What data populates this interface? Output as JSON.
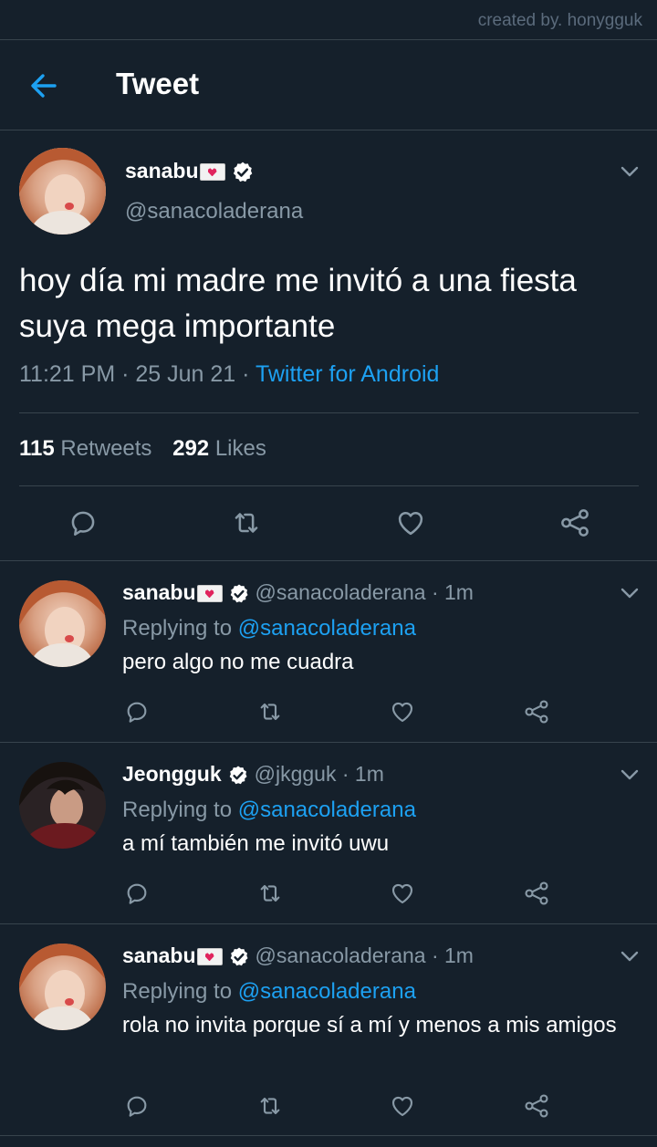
{
  "credit": "created by. honygguk",
  "header": {
    "title": "Tweet"
  },
  "main_tweet": {
    "name": "sanabu",
    "handle": "@sanacoladerana",
    "text": "hoy día mi madre me invitó a una fiesta suya mega importante",
    "time": "11:21 PM · 25 Jun 21 · ",
    "source": "Twitter for Android",
    "retweets_count": "115",
    "retweets_label": "Retweets",
    "likes_count": "292",
    "likes_label": "Likes"
  },
  "replies": [
    {
      "name": "sanabu",
      "handle": "@sanacoladerana · 1m",
      "replying_label": "Replying to ",
      "replying_to": "@sanacoladerana",
      "text": "pero algo no me cuadra"
    },
    {
      "name": "Jeongguk",
      "handle": "@jkgguk · 1m",
      "replying_label": "Replying to ",
      "replying_to": "@sanacoladerana",
      "text": "a mí también me invitó uwu"
    },
    {
      "name": "sanabu",
      "handle": "@sanacoladerana · 1m",
      "replying_label": "Replying to ",
      "replying_to": "@sanacoladerana",
      "text": "rola no invita porque sí a mí y menos a mis amigos"
    }
  ],
  "colors": {
    "background": "#15202b",
    "accent": "#1da1f2",
    "secondary_text": "#8899a6",
    "divider": "#38444d"
  },
  "icons": [
    "back-arrow-icon",
    "verified-icon",
    "chevron-down-icon",
    "reply-icon",
    "retweet-icon",
    "like-icon",
    "share-icon",
    "envelope-heart-emoji"
  ]
}
